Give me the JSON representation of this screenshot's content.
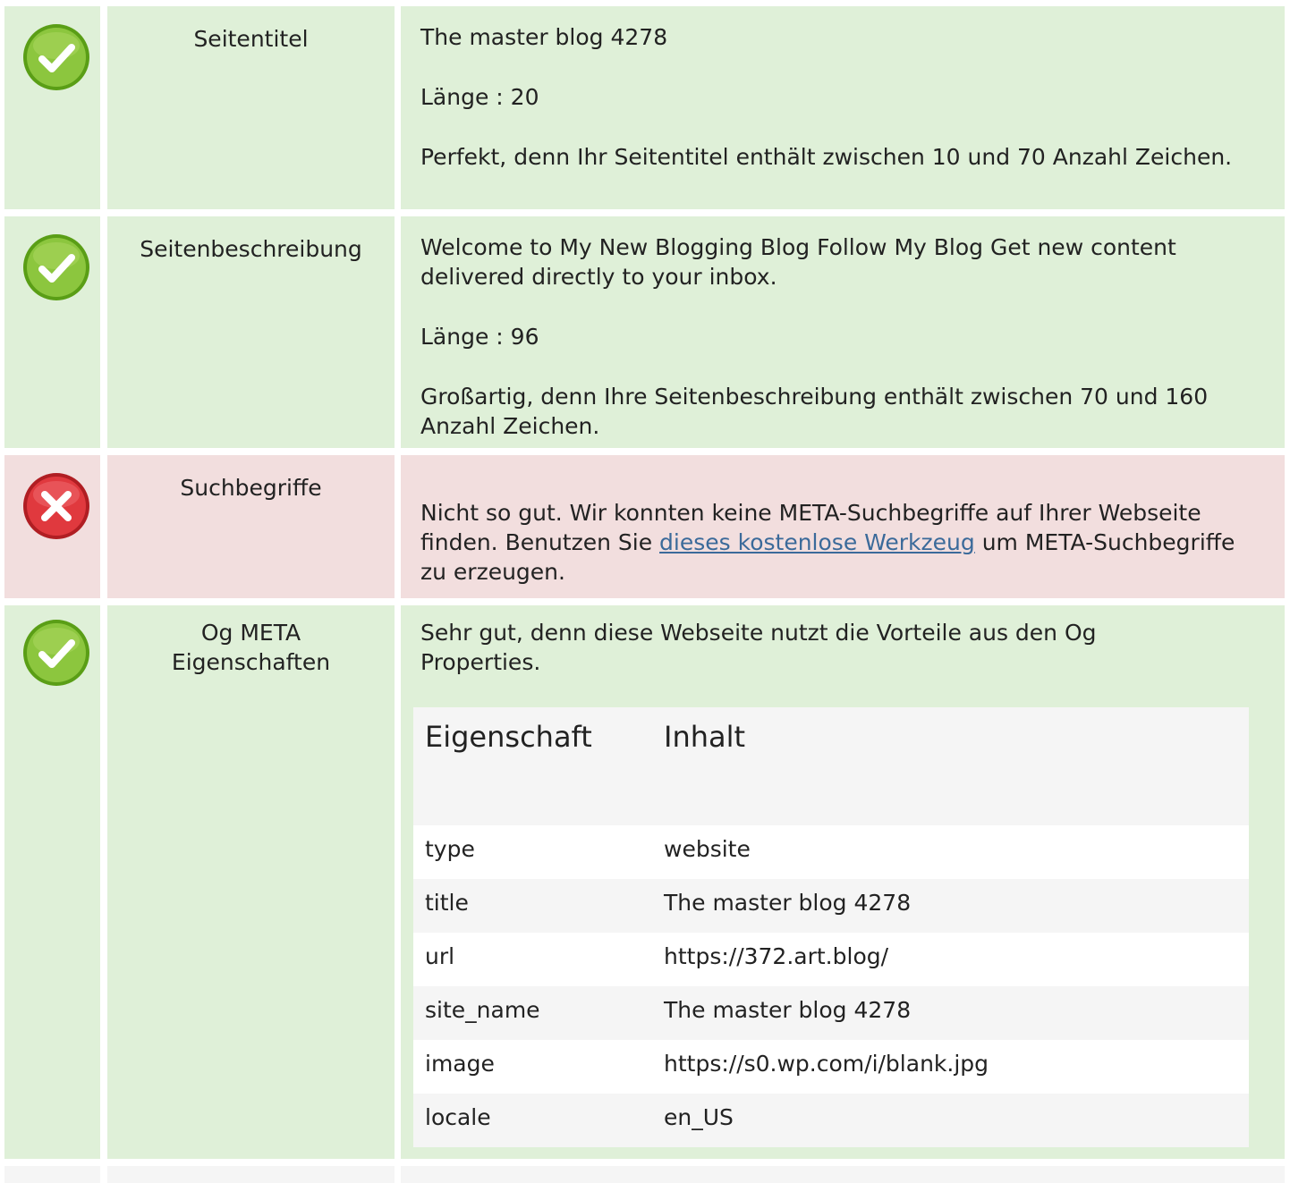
{
  "colors": {
    "ok": "#dff0d8",
    "error": "#f2dede",
    "link": "#3b6a9a"
  },
  "rows": [
    {
      "status": "ok",
      "icon": "check-icon",
      "label": "Seitentitel",
      "value": "The master blog 4278",
      "length": "Länge : 20",
      "message": "Perfekt, denn Ihr Seitentitel enthält zwischen 10 und 70 Anzahl Zeichen."
    },
    {
      "status": "ok",
      "icon": "check-icon",
      "label": "Seitenbeschreibung",
      "value": "Welcome to My New Blogging Blog Follow My Blog Get new content delivered directly to your inbox.",
      "length": "Länge : 96",
      "message": "Großartig, denn Ihre Seitenbeschreibung enthält zwischen 70 und 160 Anzahl Zeichen."
    },
    {
      "status": "error",
      "icon": "cross-icon",
      "label": "Suchbegriffe",
      "message_before": "Nicht so gut. Wir konnten keine META-Suchbegriffe auf Ihrer Webseite finden. Benutzen Sie ",
      "link_text": "dieses kostenlose Werkzeug",
      "message_after": " um META-Suchbegriffe zu erzeugen."
    },
    {
      "status": "ok",
      "icon": "check-icon",
      "label_line1": "Og META",
      "label_line2": "Eigenschaften",
      "message": "Sehr gut, denn diese Webseite nutzt die Vorteile aus den Og Properties.",
      "table": {
        "headers": [
          "Eigenschaft",
          "Inhalt"
        ],
        "rows": [
          [
            "type",
            "website"
          ],
          [
            "title",
            "The master blog 4278"
          ],
          [
            "url",
            "https://372.art.blog/"
          ],
          [
            "site_name",
            "The master blog 4278"
          ],
          [
            "image",
            "https://s0.wp.com/i/blank.jpg"
          ],
          [
            "locale",
            "en_US"
          ]
        ]
      }
    }
  ]
}
